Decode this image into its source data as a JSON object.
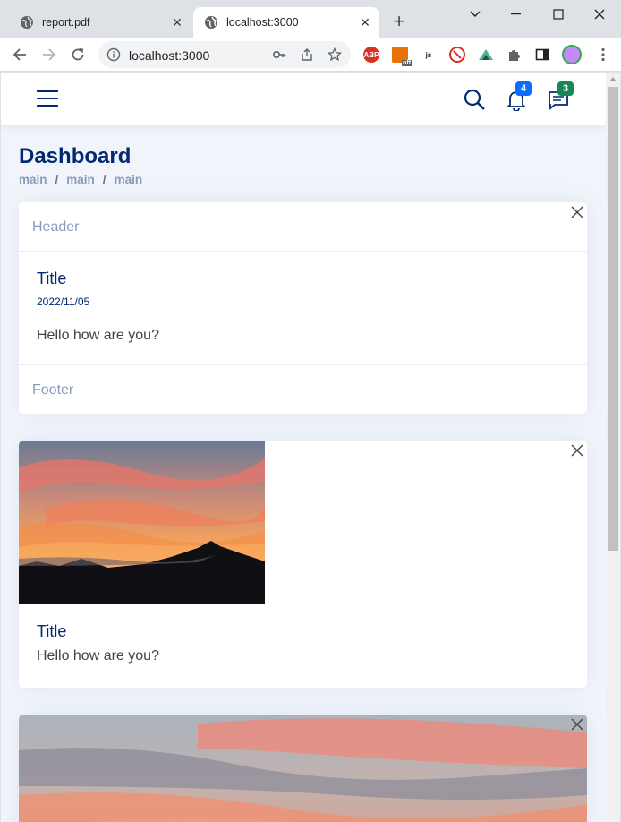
{
  "browser": {
    "tabs": [
      {
        "title": "report.pdf",
        "active": false
      },
      {
        "title": "localhost:3000",
        "active": true
      }
    ],
    "url": "localhost:3000",
    "extensions": [
      "ABP",
      "off",
      "js"
    ]
  },
  "app": {
    "notifications_count": "4",
    "messages_count": "3",
    "colors": {
      "brand": "#012970",
      "muted": "#899bbd",
      "notif_badge": "#0d6efd",
      "msg_badge": "#198754",
      "bg": "#f1f5fb"
    }
  },
  "page": {
    "title": "Dashboard",
    "breadcrumb": [
      "main",
      "main",
      "main"
    ]
  },
  "cards": [
    {
      "header": "Header",
      "title": "Title",
      "date": "2022/11/05",
      "text": "Hello how are you?",
      "footer": "Footer"
    },
    {
      "image": "sunset-over-mountains",
      "title": "Title",
      "text": "Hello how are you?"
    },
    {
      "image": "sunset-sky"
    }
  ]
}
